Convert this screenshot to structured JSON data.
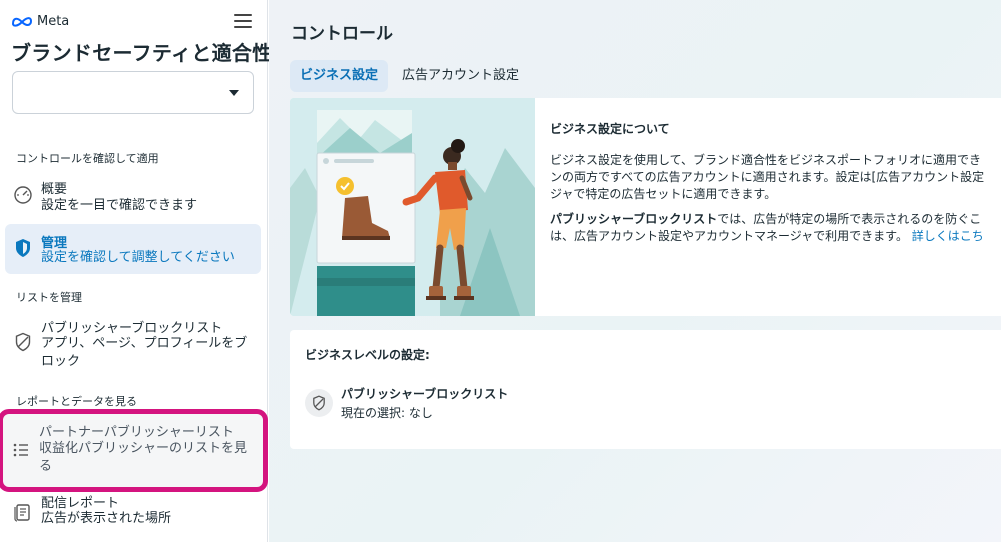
{
  "brand": {
    "logo_text": "Meta",
    "icon": "meta-logo-icon"
  },
  "header": {
    "menu_icon": "hamburger-menu-icon"
  },
  "sidebar": {
    "title": "ブランドセーフティと適合性",
    "account_select": {
      "value": "",
      "icon": "chevron-down-icon"
    },
    "sections": [
      {
        "label": "コントロールを確認して適用"
      },
      {
        "label": "リストを管理"
      },
      {
        "label": "レポートとデータを見る"
      }
    ],
    "items": [
      {
        "title": "概要",
        "sub": "設定を一目で確認できます",
        "icon": "gauge-icon"
      },
      {
        "title": "管理",
        "sub": "設定を確認して調整してください",
        "icon": "shield-icon"
      },
      {
        "title": "パブリッシャーブロックリスト",
        "sub": "アプリ、ページ、プロフィールをブロック",
        "icon": "shield-slash-icon"
      },
      {
        "title": "パートナーパブリッシャーリスト",
        "sub": "収益化パブリッシャーのリストを見る",
        "icon": "list-icon"
      },
      {
        "title": "配信レポート",
        "sub": "広告が表示された場所",
        "icon": "report-icon"
      }
    ]
  },
  "main": {
    "title": "コントロール",
    "tabs": [
      {
        "label": "ビジネス設定"
      },
      {
        "label": "広告アカウント設定"
      }
    ],
    "info": {
      "heading": "ビジネス設定について",
      "p1_line1": "ビジネス設定を使用して、ブランド適合性をビジネスポートフォリオに適用でき",
      "p1_line2": "ンの両方ですべての広告アカウントに適用されます。設定は[広告アカウント設定",
      "p1_line3": "ジャで特定の広告セットに適用できます。",
      "p2_bold": "パブリッシャーブロックリスト",
      "p2_line1_rest": "では、広告が特定の場所で表示されるのを防ぐこ",
      "p2_line2": "は、広告アカウント設定やアカウントマネージャで利用できます。",
      "learn_more": "詳しくはこち"
    },
    "level": {
      "heading": "ビジネスレベルの設定:",
      "item_title": "パブリッシャーブロックリスト",
      "item_sub": "現在の選択: なし",
      "item_icon": "shield-slash-icon"
    }
  },
  "colors": {
    "accent": "#0a78be",
    "active_bg": "#e6eef8",
    "highlight_outline": "#d4147f",
    "illustration_bg": "#d4ecee"
  }
}
